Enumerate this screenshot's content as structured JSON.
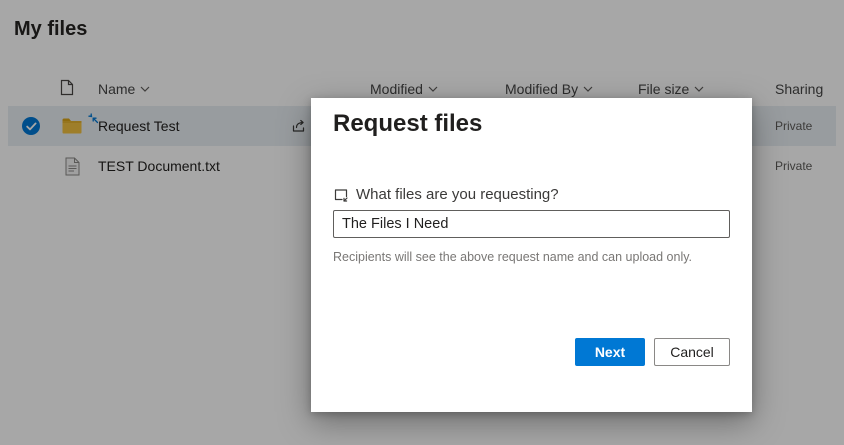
{
  "page": {
    "title": "My files"
  },
  "colors": {
    "accent": "#0078d4",
    "selected_row": "#e9eef3",
    "overlay": "rgba(0,0,0,0.345)",
    "primary_button": "#0078d4"
  },
  "files": {
    "columns": [
      {
        "label": "Name",
        "sortable": true
      },
      {
        "label": "Modified",
        "sortable": true
      },
      {
        "label": "Modified By",
        "sortable": true
      },
      {
        "label": "File size",
        "sortable": true
      },
      {
        "label": "Sharing",
        "sortable": false
      }
    ],
    "rows": [
      {
        "name": "Request Test",
        "type": "folder",
        "sharing": "Private",
        "selected": true,
        "new_badge": true
      },
      {
        "name": "TEST Document.txt",
        "type": "text-file",
        "sharing": "Private",
        "selected": false,
        "new_badge": false
      }
    ]
  },
  "dialog": {
    "title": "Request files",
    "field_label": "What files are you requesting?",
    "field_value": "The Files I Need",
    "helper_text": "Recipients will see the above request name and can upload only.",
    "next_label": "Next",
    "cancel_label": "Cancel"
  },
  "icons": {
    "header_file": "file-icon",
    "sort": "chevron-down-icon",
    "selected": "check-circle-icon",
    "folder": "folder-icon",
    "text_file": "text-document-icon",
    "new_item": "new-sparkle-icon",
    "share": "share-icon",
    "request": "request-files-icon"
  }
}
